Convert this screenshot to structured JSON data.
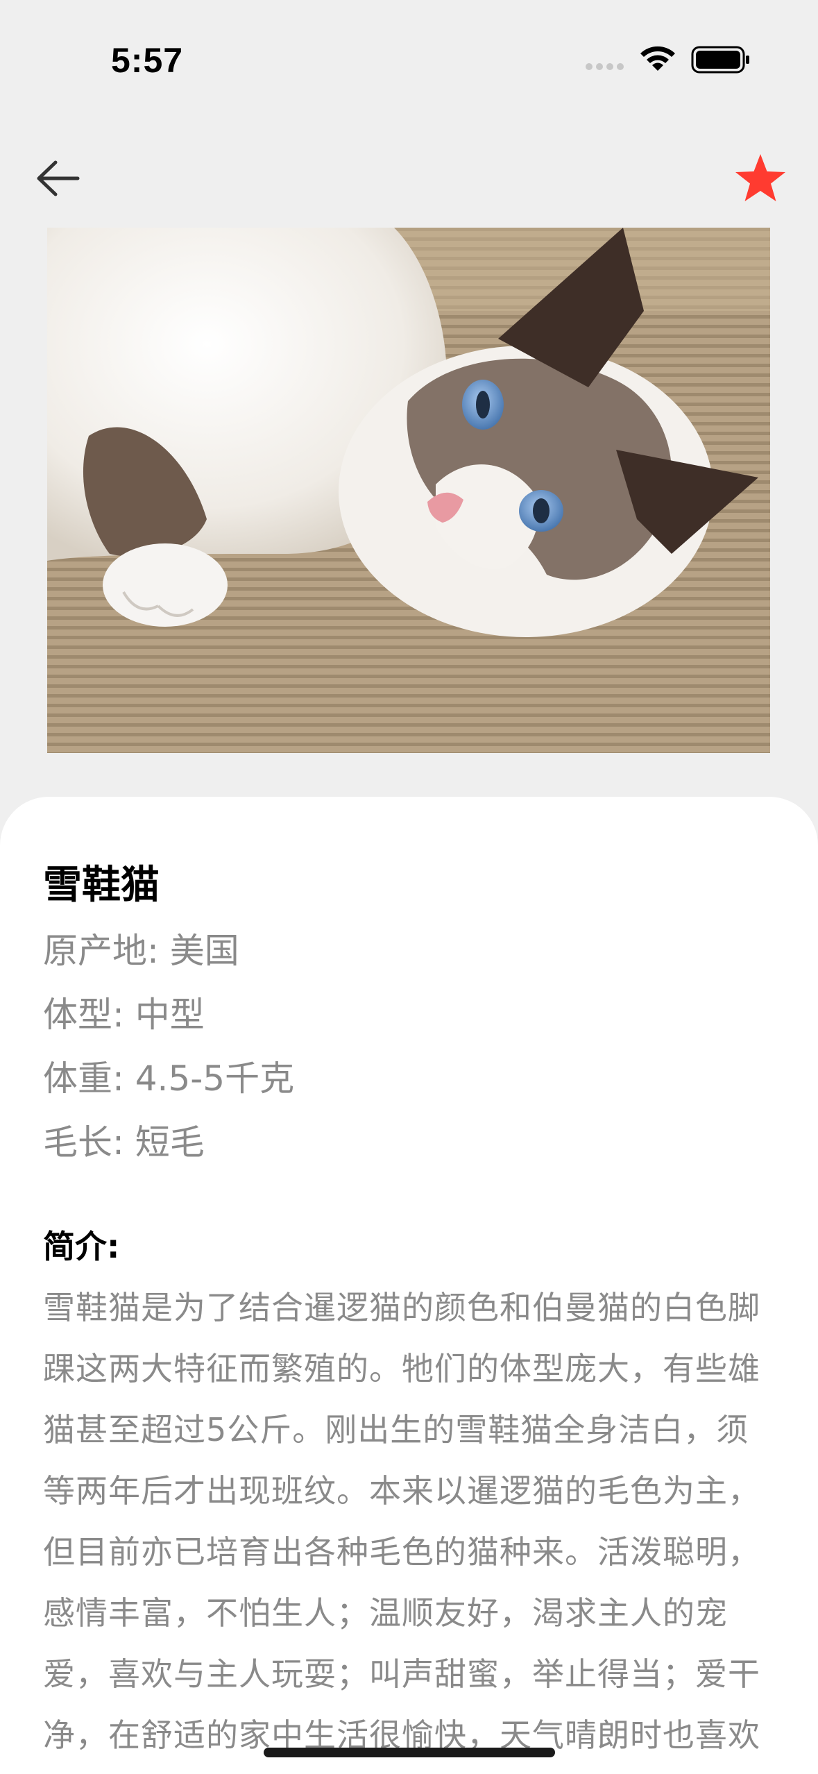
{
  "status_bar": {
    "time": "5:57"
  },
  "nav": {
    "back_icon": "arrow-left-icon",
    "favorite_icon": "star-icon",
    "favorite_color": "#ff3b30"
  },
  "breed": {
    "name": "雪鞋猫",
    "attributes": [
      "原产地: 美国",
      "体型: 中型",
      "体重: 4.5-5千克",
      "毛长: 短毛"
    ],
    "intro_label": "简介:",
    "intro_text": "雪鞋猫是为了结合暹逻猫的颜色和伯曼猫的白色脚踝这两大特征而繁殖的。牠们的体型庞大，有些雄猫甚至超过5公斤。刚出生的雪鞋猫全身洁白，须等两年后才出现班纹。本来以暹逻猫的毛色为主，但目前亦已培育出各种毛色的猫种来。活泼聪明，感情丰富，不怕生人；温顺友好，渴求主人的宠爱，喜欢与主人玩耍；叫声甜蜜，举止得当；爱干净，在舒适的家中生活很愉快，天气晴朗时也喜欢"
  }
}
